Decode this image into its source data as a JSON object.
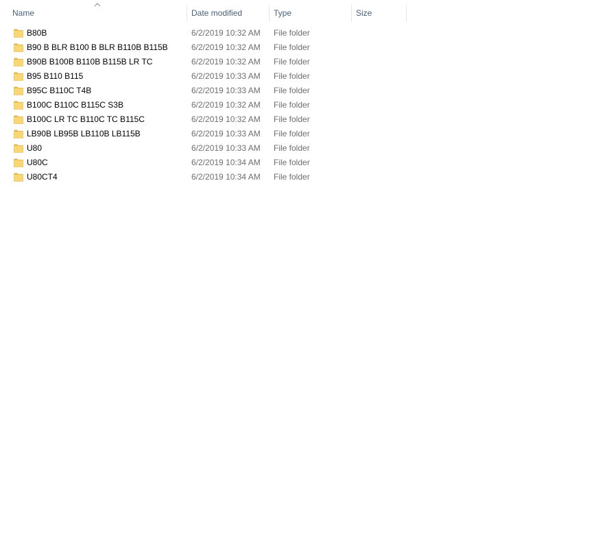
{
  "columns": {
    "name": "Name",
    "date_modified": "Date modified",
    "type": "Type",
    "size": "Size"
  },
  "sort": {
    "column": "name",
    "direction": "ascending",
    "icon": "chevron-up-icon"
  },
  "colors": {
    "header_text": "#4c607a",
    "detail_text": "#6d6d6d",
    "folder_fill": "#f8d775",
    "folder_edge": "#e0b34a"
  },
  "items": [
    {
      "name": "B80B",
      "date": "6/2/2019 10:32 AM",
      "type": "File folder",
      "size": "",
      "icon": "folder-icon"
    },
    {
      "name": "B90 B BLR B100 B BLR B110B B115B",
      "date": "6/2/2019 10:32 AM",
      "type": "File folder",
      "size": "",
      "icon": "folder-icon"
    },
    {
      "name": "B90B B100B B110B B115B LR TC",
      "date": "6/2/2019 10:32 AM",
      "type": "File folder",
      "size": "",
      "icon": "folder-icon"
    },
    {
      "name": "B95 B110 B115",
      "date": "6/2/2019 10:33 AM",
      "type": "File folder",
      "size": "",
      "icon": "folder-icon"
    },
    {
      "name": "B95C B110C T4B",
      "date": "6/2/2019 10:33 AM",
      "type": "File folder",
      "size": "",
      "icon": "folder-icon"
    },
    {
      "name": "B100C B110C B115C S3B",
      "date": "6/2/2019 10:32 AM",
      "type": "File folder",
      "size": "",
      "icon": "folder-icon"
    },
    {
      "name": "B100C LR TC B110C TC B115C",
      "date": "6/2/2019 10:32 AM",
      "type": "File folder",
      "size": "",
      "icon": "folder-icon"
    },
    {
      "name": "LB90B LB95B LB110B LB115B",
      "date": "6/2/2019 10:33 AM",
      "type": "File folder",
      "size": "",
      "icon": "folder-icon"
    },
    {
      "name": "U80",
      "date": "6/2/2019 10:33 AM",
      "type": "File folder",
      "size": "",
      "icon": "folder-icon"
    },
    {
      "name": "U80C",
      "date": "6/2/2019 10:34 AM",
      "type": "File folder",
      "size": "",
      "icon": "folder-icon"
    },
    {
      "name": "U80CT4",
      "date": "6/2/2019 10:34 AM",
      "type": "File folder",
      "size": "",
      "icon": "folder-icon"
    }
  ]
}
